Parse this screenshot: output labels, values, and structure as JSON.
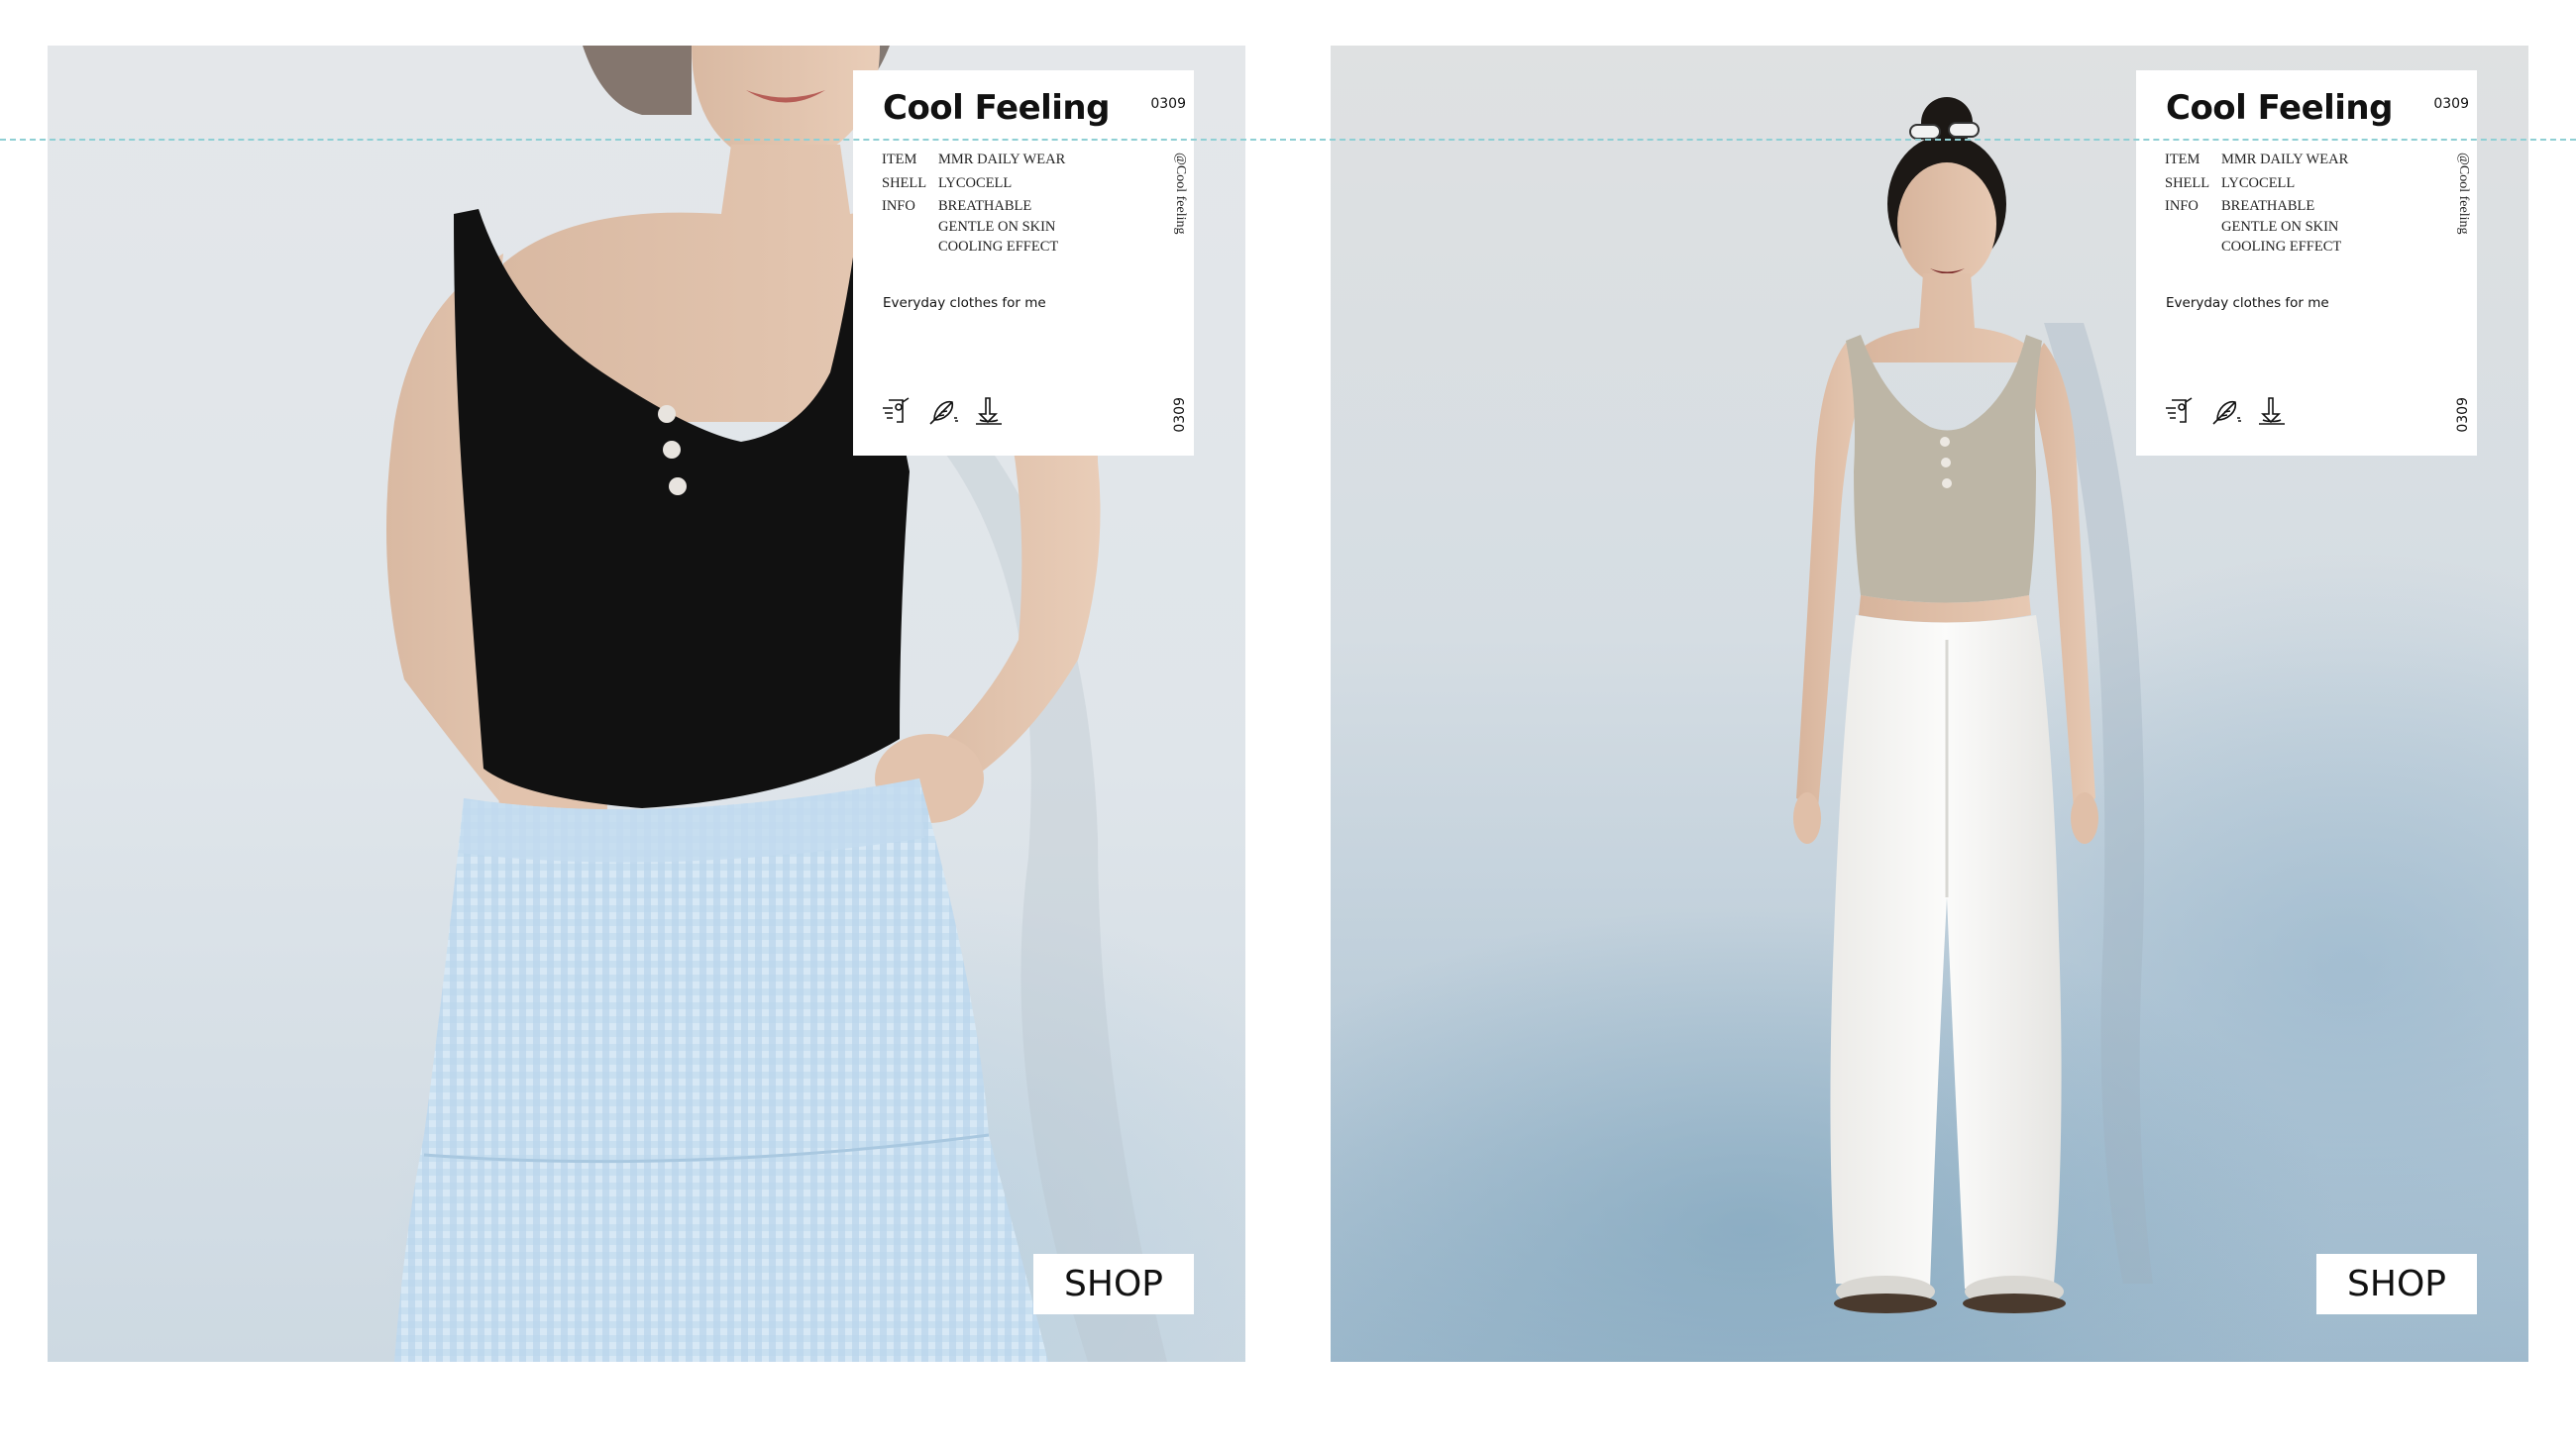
{
  "colors": {
    "page_background": "#ffffff",
    "card_background": "#ffffff",
    "guide_line": "#8fcfd4",
    "tank_black": "#111111",
    "tank_beige": "#bdb6a6",
    "skirt_gingham": "#c9dff0",
    "pants_white": "#f6f6f4"
  },
  "cards": [
    {
      "title": "Cool Feeling",
      "code": "0309",
      "code_vertical": "0309",
      "handle": "@Cool feeling",
      "item_key": "ITEM",
      "item_value": "MMR DAILY WEAR",
      "shell_key": "SHELL",
      "shell_value": "LYCOCELL",
      "info_key": "INFO",
      "info_values": [
        "BREATHABLE",
        "GENTLE ON SKIN",
        "COOLING EFFECT"
      ],
      "tagline": "Everyday clothes for me",
      "icons": [
        "cooling-fan-icon",
        "feather-icon",
        "washing-hand-icon"
      ],
      "shop_label": "SHOP"
    },
    {
      "title": "Cool Feeling",
      "code": "0309",
      "code_vertical": "0309",
      "handle": "@Cool feeling",
      "item_key": "ITEM",
      "item_value": "MMR DAILY WEAR",
      "shell_key": "SHELL",
      "shell_value": "LYCOCELL",
      "info_key": "INFO",
      "info_values": [
        "BREATHABLE",
        "GENTLE ON SKIN",
        "COOLING EFFECT"
      ],
      "tagline": "Everyday clothes for me",
      "icons": [
        "cooling-fan-icon",
        "feather-icon",
        "washing-hand-icon"
      ],
      "shop_label": "SHOP"
    }
  ]
}
